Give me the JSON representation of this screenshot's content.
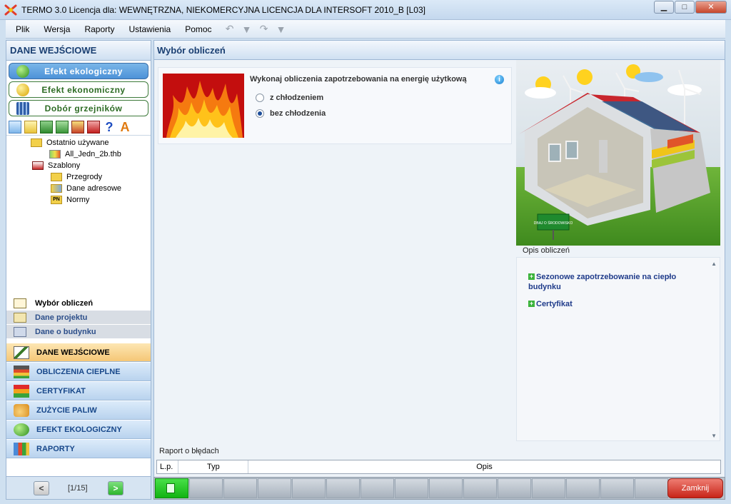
{
  "window": {
    "title": "TERMO 3.0 Licencja dla: WEWNĘTRZNA, NIEKOMERCYJNA LICENCJA DLA INTERSOFT 2010_B [L03]",
    "minimize": "▁",
    "maximize": "□",
    "close": "✕"
  },
  "menu": {
    "items": [
      "Plik",
      "Wersja",
      "Raporty",
      "Ustawienia",
      "Pomoc"
    ]
  },
  "left_panel": {
    "header": "DANE WEJŚCIOWE",
    "modules": [
      {
        "label": "Efekt ekologiczny",
        "active": true
      },
      {
        "label": "Efekt ekonomiczny",
        "active": false
      },
      {
        "label": "Dobór grzejników",
        "active": false
      }
    ],
    "tree": {
      "recent_label": "Ostatnio używane",
      "recent_file": "All_Jedn_2b.thb",
      "templates_label": "Szablony",
      "templates": [
        "Przegrody",
        "Dane adresowe",
        "Normy"
      ]
    },
    "subnav": [
      "Wybór obliczeń",
      "Dane projektu",
      "Dane o budynku"
    ],
    "nav": [
      "DANE WEJŚCIOWE",
      "OBLICZENIA CIEPLNE",
      "CERTYFIKAT",
      "ZUŻYCIE PALIW",
      "EFEKT EKOLOGICZNY",
      "RAPORTY"
    ],
    "pager": {
      "prev": "<",
      "text": "[1/15]",
      "next": ">"
    }
  },
  "content": {
    "header": "Wybór obliczeń",
    "calc_title": "Wykonaj obliczenia zapotrzebowania na energię użytkową",
    "info": "i",
    "options": [
      {
        "label": "z chłodzeniem",
        "checked": false
      },
      {
        "label": "bez chłodzenia",
        "checked": true
      }
    ],
    "sign_text": "DBAJ O ŚRODOWISKO",
    "opis_label": "Opis obliczeń",
    "opis_items": [
      "Sezonowe zapotrzebowanie na ciepło budynku",
      "Certyfikat"
    ],
    "raport_label": "Raport o błędach",
    "raport_columns": [
      "L.p.",
      "Typ",
      "Opis"
    ],
    "close_button": "Zamknij"
  }
}
